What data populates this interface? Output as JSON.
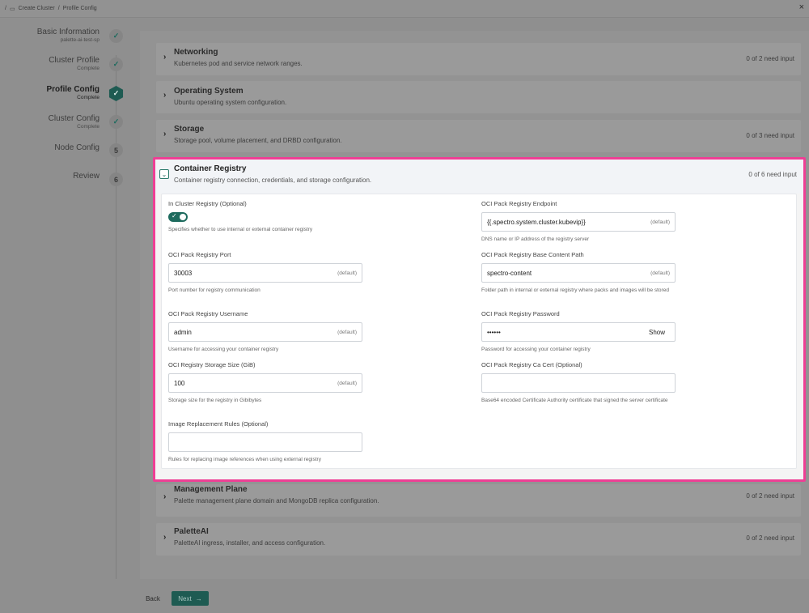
{
  "breadcrumb": {
    "create": "Create Cluster",
    "separator": "/",
    "current": "Profile Config"
  },
  "steps": [
    {
      "name": "Basic Information",
      "sub": "palette-ai-test-sp",
      "badge": "✓"
    },
    {
      "name": "Cluster Profile",
      "sub": "Complete",
      "badge": "✓"
    },
    {
      "name": "Profile Config",
      "sub": "Complete",
      "badge": "✓"
    },
    {
      "name": "Cluster Config",
      "sub": "Complete",
      "badge": "✓"
    },
    {
      "name": "Node Config",
      "sub": "",
      "badge": "5"
    },
    {
      "name": "Review",
      "sub": "",
      "badge": "6"
    }
  ],
  "sections": {
    "networking": {
      "title": "Networking",
      "desc": "Kubernetes pod and service network ranges.",
      "status": "0 of 2 need input"
    },
    "os": {
      "title": "Operating System",
      "desc": "Ubuntu operating system configuration.",
      "status": ""
    },
    "storage": {
      "title": "Storage",
      "desc": "Storage pool, volume placement, and DRBD configuration.",
      "status": "0 of 3 need input"
    },
    "registry": {
      "title": "Container Registry",
      "desc": "Container registry connection, credentials, and storage configuration.",
      "status": "0 of 6 need input"
    },
    "mgmt": {
      "title": "Management Plane",
      "desc": "Palette management plane domain and MongoDB replica configuration.",
      "status": "0 of 2 need input"
    },
    "paletteai": {
      "title": "PaletteAI",
      "desc": "PaletteAI ingress, installer, and access configuration.",
      "status": "0 of 2 need input"
    }
  },
  "form": {
    "in_cluster": {
      "label": "In Cluster Registry  (Optional)",
      "help": "Specifies whether to use internal or external container registry"
    },
    "endpoint": {
      "label": "OCI Pack Registry Endpoint",
      "value": "{{.spectro.system.cluster.kubevip}}",
      "default": "(default)",
      "help": "DNS name or IP address of the registry server"
    },
    "port": {
      "label": "OCI Pack Registry Port",
      "value": "30003",
      "default": "(default)",
      "help": "Port number for registry communication"
    },
    "base_path": {
      "label": "OCI Pack Registry Base Content Path",
      "value": "spectro-content",
      "default": "(default)",
      "help": "Folder path in internal or external registry where packs and images will be stored"
    },
    "username": {
      "label": "OCI Pack Registry Username",
      "value": "admin",
      "default": "(default)",
      "help": "Username for accessing your container registry"
    },
    "password": {
      "label": "OCI Pack Registry Password",
      "value": "••••••",
      "show": "Show",
      "help": "Password for accessing your container registry"
    },
    "storage_size": {
      "label": "OCI Registry Storage Size (GiB)",
      "value": "100",
      "default": "(default)",
      "help": "Storage size for the registry in Gibibytes"
    },
    "ca_cert": {
      "label": "OCI Pack Registry Ca Cert  (Optional)",
      "value": "",
      "help": "Base64 encoded Certificate Authority certificate that signed the server certificate"
    },
    "image_rules": {
      "label": "Image Replacement Rules  (Optional)",
      "value": "",
      "help": "Rules for replacing image references when using external registry"
    }
  },
  "footer": {
    "back": "Back",
    "next": "Next",
    "next_arrow": "→"
  },
  "icons": {
    "close": "×",
    "chevron_right": "›",
    "chevron_down": "⌄"
  },
  "colors": {
    "accent": "#1e6b5e",
    "highlight": "#ee3f95"
  }
}
